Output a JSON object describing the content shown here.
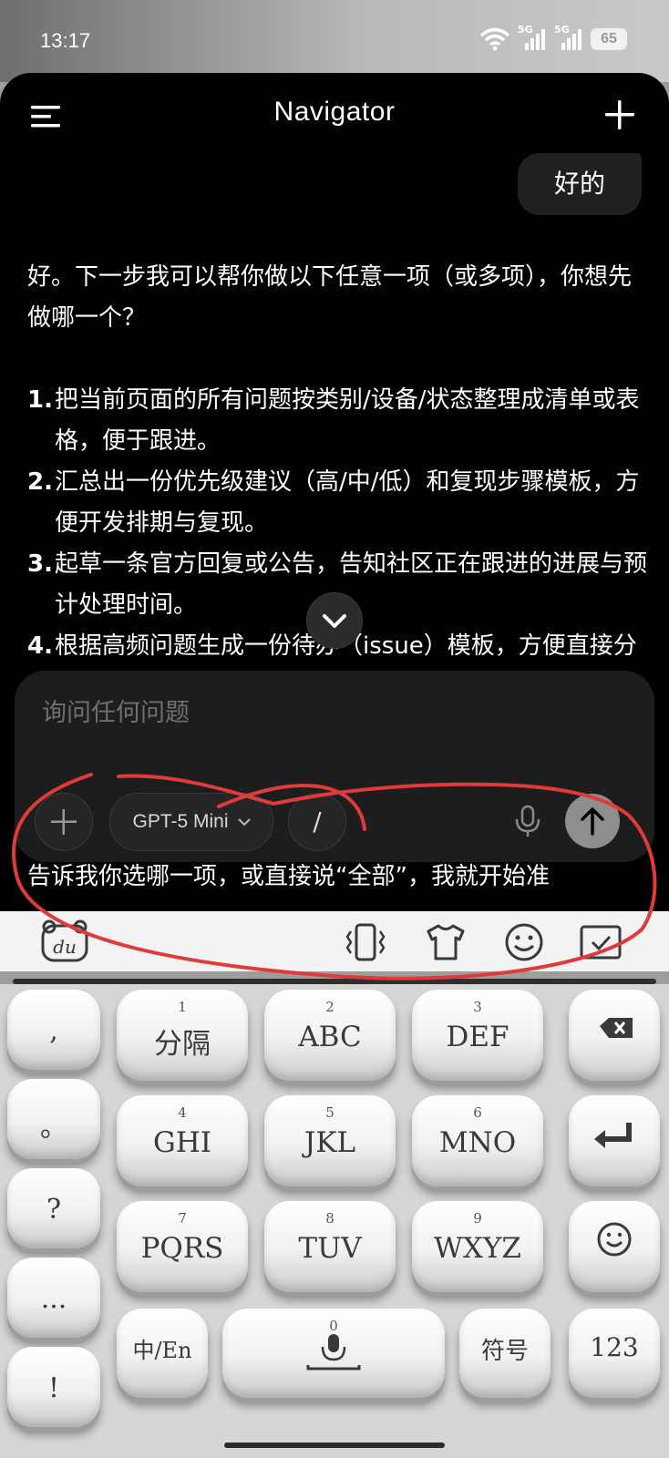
{
  "status": {
    "time": "13:17",
    "network1": "5G",
    "network2": "5G",
    "battery": "65"
  },
  "header": {
    "title": "Navigator"
  },
  "chat": {
    "user_message": "好的",
    "reply_intro": "好。下一步我可以帮你做以下任意一项（或多项），你想先做哪一个？",
    "items": [
      {
        "num": "1.",
        "text": "把当前页面的所有问题按类别/设备/状态整理成清单或表格，便于跟进。"
      },
      {
        "num": "2.",
        "text": "汇总出一份优先级建议（高/中/低）和复现步骤模板，方便开发排期与复现。"
      },
      {
        "num": "3.",
        "text": "起草一条官方回复或公告，告知社区正在跟进的进展与预计处理时间。"
      },
      {
        "num": "4.",
        "text": "根据高频问题生成一份待办（issue）模板，方便直接分配给工程/QA"
      }
    ],
    "closing_peek": "告诉我你选哪一项，或直接说“全部”，我就开始准"
  },
  "composer": {
    "placeholder": "询问任何问题",
    "model_label": "GPT-5 Mini",
    "slash_label": "/"
  },
  "keyboard": {
    "side_keys": [
      ",",
      "。",
      "?",
      "...",
      "!"
    ],
    "keys": [
      {
        "digit": "1",
        "label": "分隔"
      },
      {
        "digit": "2",
        "label": "ABC"
      },
      {
        "digit": "3",
        "label": "DEF"
      },
      {
        "digit": "4",
        "label": "GHI"
      },
      {
        "digit": "5",
        "label": "JKL"
      },
      {
        "digit": "6",
        "label": "MNO"
      },
      {
        "digit": "7",
        "label": "PQRS"
      },
      {
        "digit": "8",
        "label": "TUV"
      },
      {
        "digit": "9",
        "label": "WXYZ"
      }
    ],
    "switch_label": "中/En",
    "space_digit": "0",
    "symbol_label": "符号",
    "numbers_label": "123"
  },
  "colors": {
    "app_bg": "#000000",
    "composer_bg": "#1d1d1d",
    "annotation": "#e03a3a"
  }
}
